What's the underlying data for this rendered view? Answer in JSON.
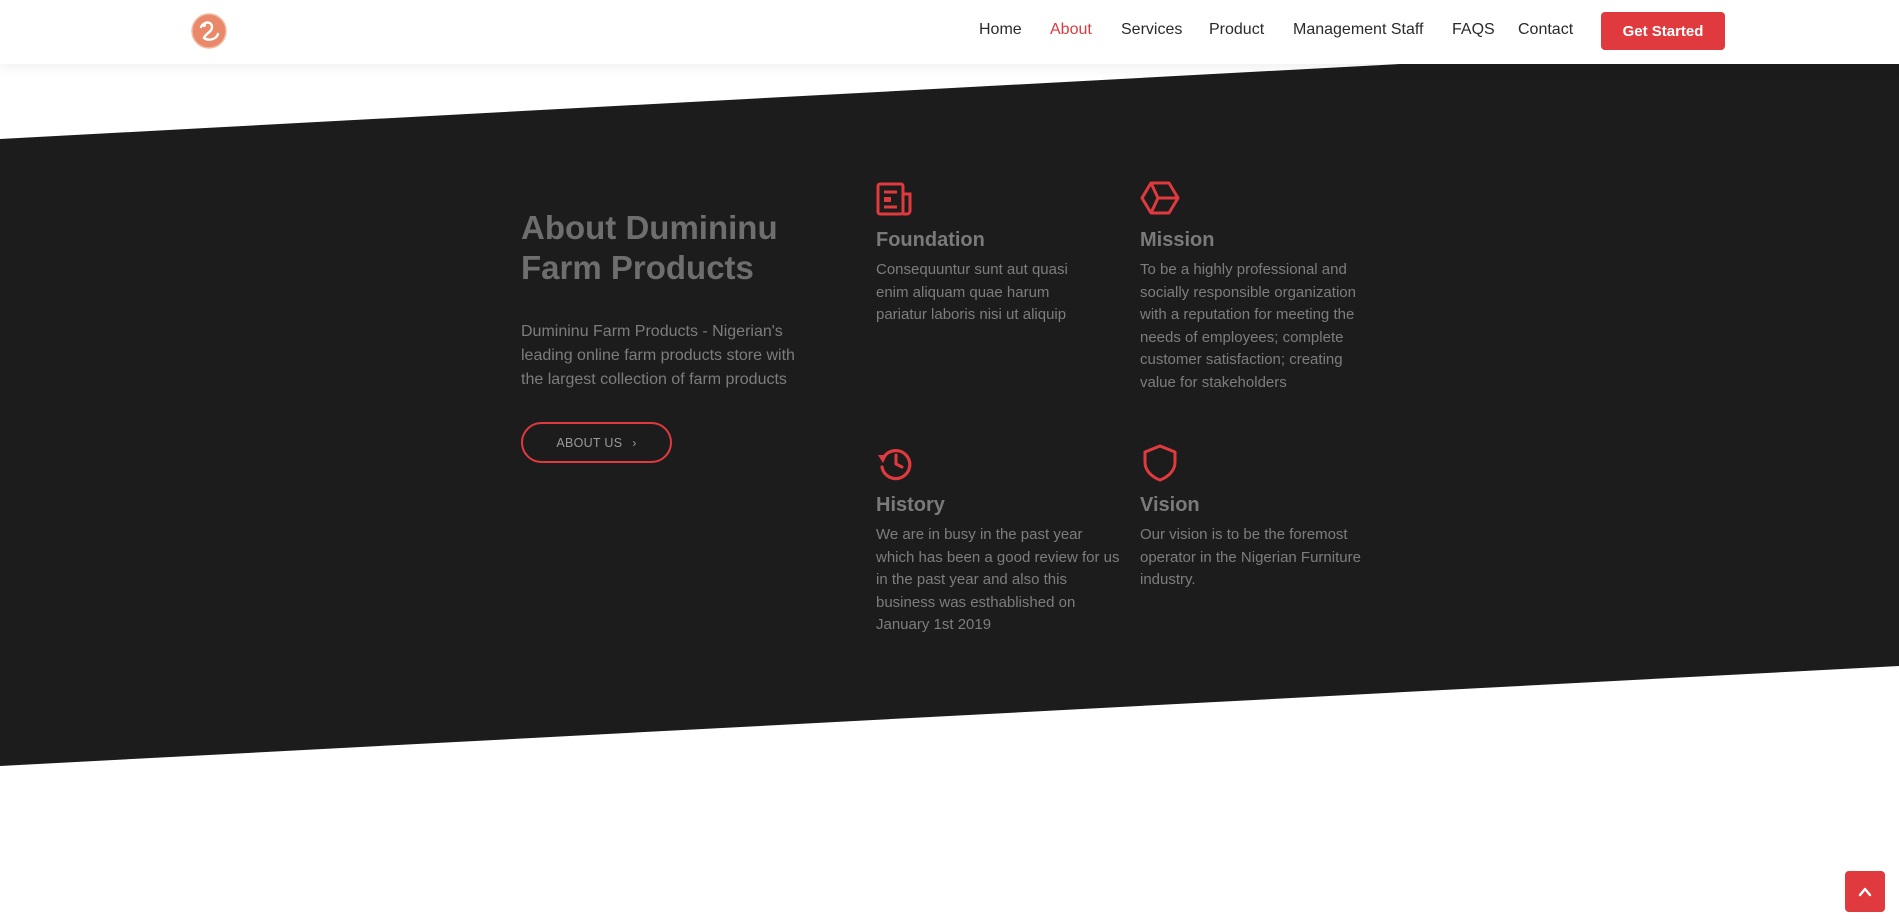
{
  "nav": {
    "items": [
      {
        "label": "Home",
        "active": false
      },
      {
        "label": "About",
        "active": true
      },
      {
        "label": "Services",
        "active": false
      },
      {
        "label": "Product",
        "active": false
      },
      {
        "label": "Management Staff",
        "active": false
      },
      {
        "label": "FAQS",
        "active": false
      },
      {
        "label": "Contact",
        "active": false
      }
    ],
    "cta_label": "Get Started"
  },
  "about": {
    "title": "About Dumininu Farm Products",
    "text": "Dumininu Farm Products - Nigerian's leading online farm products store with the largest collection of farm products",
    "button_label": "ABOUT US"
  },
  "features": [
    {
      "icon": "newspaper-icon",
      "title": "Foundation",
      "text": "Consequuntur sunt aut quasi enim aliquam quae harum pariatur laboris nisi ut aliquip"
    },
    {
      "icon": "cube-icon",
      "title": "Mission",
      "text": "To be a highly professional and socially responsible organization with a reputation for meeting the needs of employees; complete customer satisfaction; creating value for stakeholders"
    },
    {
      "icon": "history-icon",
      "title": "History",
      "text": "We are in busy in the past year which has been a good review for us in the past year and also this business was esthablished on January 1st 2019"
    },
    {
      "icon": "shield-icon",
      "title": "Vision",
      "text": "Our vision is to be the foremost operator in the Nigerian Furniture industry."
    }
  ],
  "colors": {
    "accent": "#e03a3e",
    "dark_section": "#1c1c1d",
    "logo": "#e9896a"
  }
}
